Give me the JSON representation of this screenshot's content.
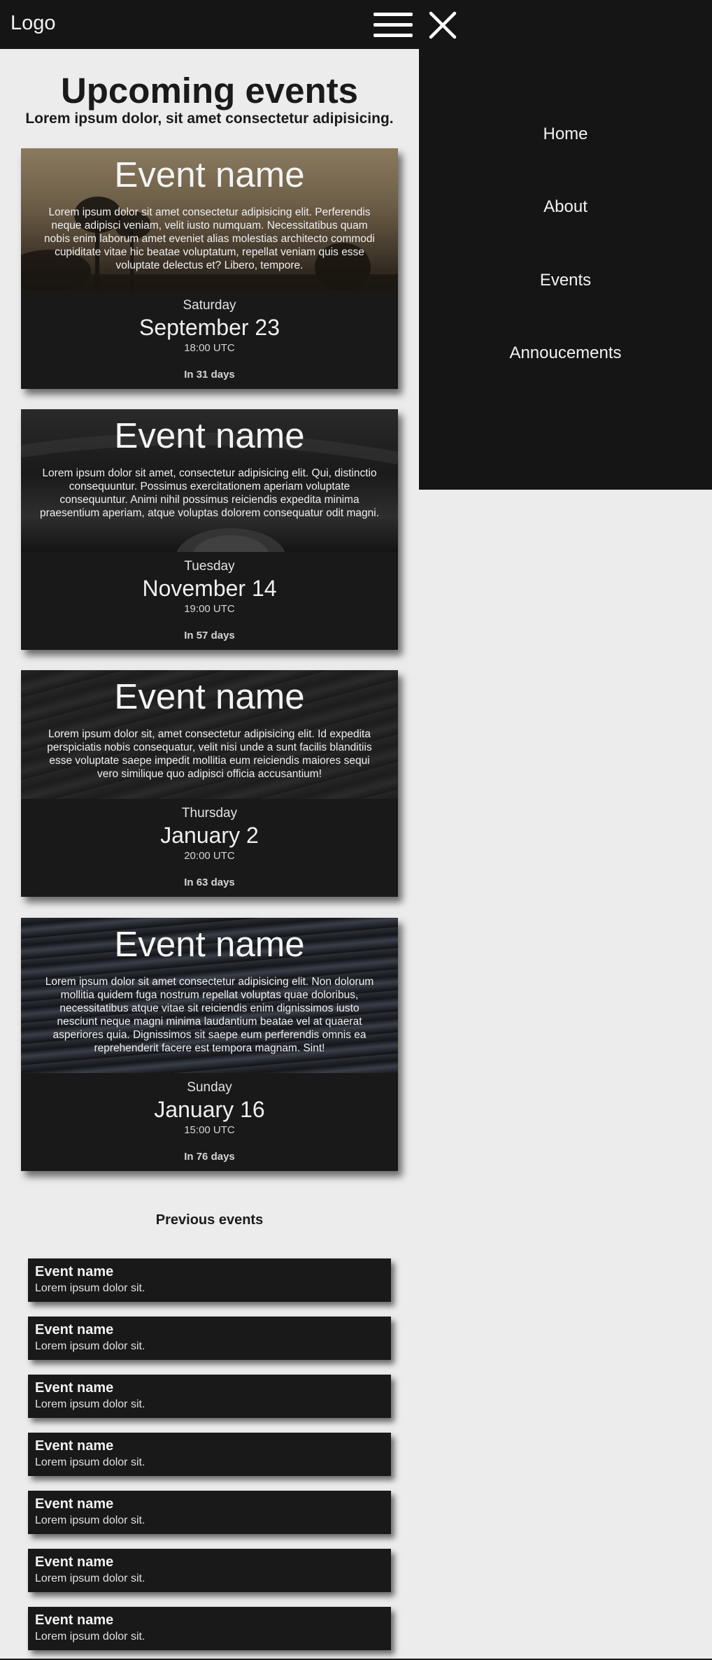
{
  "header": {
    "logo": "Logo",
    "menu_icon": "hamburger-icon",
    "close_icon": "close-icon"
  },
  "nav": {
    "items": [
      "Home",
      "About",
      "Events",
      "Annoucements"
    ]
  },
  "page": {
    "title": "Upcoming events",
    "subtitle": "Lorem ipsum dolor, sit amet consectetur adipisicing."
  },
  "events": [
    {
      "name": "Event name",
      "description": "Lorem ipsum dolor sit amet consectetur adipisicing elit. Perferendis neque adipisci veniam, velit iusto numquam. Necessitatibus quam nobis enim laborum amet eveniet alias molestias architecto commodi cupiditate vitae hic beatae voluptatum, repellat veniam quis esse voluptate delectus et? Libero, tempore.",
      "weekday": "Saturday",
      "date": "September 23",
      "time": "18:00 UTC",
      "countdown": "In 31 days"
    },
    {
      "name": "Event name",
      "description": "Lorem ipsum dolor sit amet, consectetur adipisicing elit. Qui, distinctio consequuntur. Possimus exercitationem aperiam voluptate consequuntur. Animi nihil possimus reiciendis expedita minima praesentium aperiam, atque voluptas dolorem consequatur odit magni.",
      "weekday": "Tuesday",
      "date": "November 14",
      "time": "19:00 UTC",
      "countdown": "In 57 days"
    },
    {
      "name": "Event name",
      "description": "Lorem ipsum dolor sit, amet consectetur adipisicing elit. Id expedita perspiciatis nobis consequatur, velit nisi unde a sunt facilis blanditiis esse voluptate saepe impedit mollitia eum reiciendis maiores sequi vero similique quo adipisci officia accusantium!",
      "weekday": "Thursday",
      "date": "January 2",
      "time": "20:00 UTC",
      "countdown": "In 63 days"
    },
    {
      "name": "Event name",
      "description": "Lorem ipsum dolor sit amet consectetur adipisicing elit. Non dolorum mollitia quidem fuga nostrum repellat voluptas quae doloribus, necessitatibus atque vitae sit reiciendis enim dignissimos iusto nesciunt neque magni minima laudantium beatae vel at quaerat asperiores quia. Dignissimos sit saepe eum perferendis omnis ea reprehenderit facere est tempora magnam. Sint!",
      "weekday": "Sunday",
      "date": "January 16",
      "time": "15:00 UTC",
      "countdown": "In 76 days"
    }
  ],
  "previous": {
    "title": "Previous events",
    "items": [
      {
        "name": "Event name",
        "desc": "Lorem ipsum dolor sit."
      },
      {
        "name": "Event name",
        "desc": "Lorem ipsum dolor sit."
      },
      {
        "name": "Event name",
        "desc": "Lorem ipsum dolor sit."
      },
      {
        "name": "Event name",
        "desc": "Lorem ipsum dolor sit."
      },
      {
        "name": "Event name",
        "desc": "Lorem ipsum dolor sit."
      },
      {
        "name": "Event name",
        "desc": "Lorem ipsum dolor sit."
      },
      {
        "name": "Event name",
        "desc": "Lorem ipsum dolor sit."
      }
    ]
  },
  "colors": {
    "header_bg": "#151515",
    "page_bg": "#ececec",
    "card_bg": "#191919"
  }
}
